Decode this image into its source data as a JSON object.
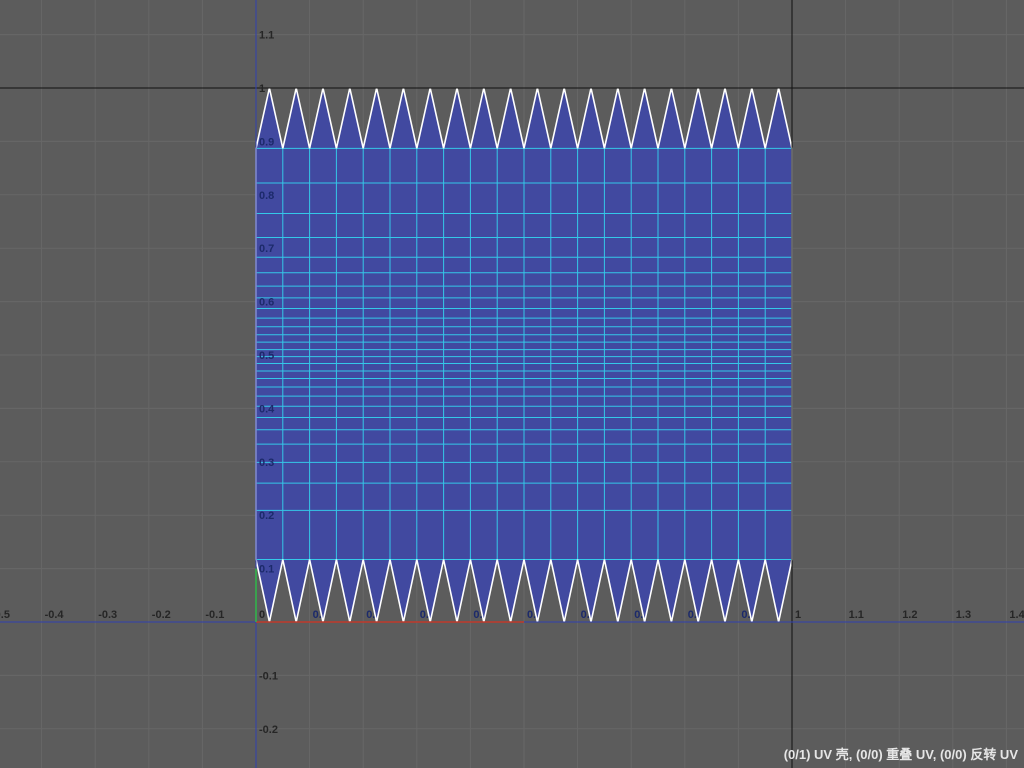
{
  "viewport": {
    "u_range": [
      -0.5,
      1.4
    ],
    "v_range": [
      -0.27,
      1.16
    ],
    "grid_step": 0.1
  },
  "axes": {
    "u_tick_labels": [
      "-0.5",
      "-0.4",
      "-0.3",
      "-0.2",
      "-0.1",
      "0",
      "0.",
      "0.",
      "0.",
      "0.",
      "0.",
      "0.",
      "0.",
      "0.",
      "0.",
      "1",
      "1.1",
      "1.2",
      "1.3",
      "1.4"
    ],
    "u_tick_values": [
      -0.5,
      -0.4,
      -0.3,
      -0.2,
      -0.1,
      0,
      0.1,
      0.2,
      0.3,
      0.4,
      0.5,
      0.6,
      0.7,
      0.8,
      0.9,
      1.0,
      1.1,
      1.2,
      1.3,
      1.4
    ],
    "v_tick_labels": [
      "-0.2",
      "-0.1",
      "0.1",
      "0.2",
      "0.3",
      "0.4",
      "0.5",
      "0.6",
      "0.7",
      "0.8",
      "0.9",
      "1",
      "1.1"
    ],
    "v_tick_values": [
      -0.2,
      -0.1,
      0.1,
      0.2,
      0.3,
      0.4,
      0.5,
      0.6,
      0.7,
      0.8,
      0.9,
      1.0,
      1.1
    ]
  },
  "uv_shell": {
    "u_min": 0.0,
    "u_max": 1.0,
    "v_body_min": 0.117,
    "v_body_max": 0.887,
    "v_tip_min": 0.0,
    "v_tip_max": 1.0,
    "zigzag_teeth": 20,
    "grid_u_lines": [
      0.05,
      0.1,
      0.15,
      0.2,
      0.25,
      0.3,
      0.35,
      0.4,
      0.45,
      0.5,
      0.55,
      0.6,
      0.65,
      0.7,
      0.75,
      0.8,
      0.85,
      0.9,
      0.95
    ],
    "grid_v_lines": [
      0.117,
      0.209,
      0.26,
      0.299,
      0.333,
      0.36,
      0.383,
      0.404,
      0.423,
      0.44,
      0.456,
      0.47,
      0.484,
      0.497,
      0.51,
      0.524,
      0.538,
      0.553,
      0.569,
      0.587,
      0.607,
      0.629,
      0.654,
      0.683,
      0.72,
      0.765,
      0.822,
      0.887
    ]
  },
  "colors": {
    "background": "#5c5c5c",
    "grid": "#676767",
    "u_axis": "#2f3fb0",
    "v_axis": "#2f3fb0",
    "frame_line": "#111111",
    "shell_fill": "#4149a0",
    "shell_edge": "#ffffff",
    "shell_grid": "#34c8e8",
    "label": "#262626",
    "label_inside": "#1c2a6b"
  },
  "status_bar": {
    "text": "(0/1) UV 壳, (0/0) 重叠 UV, (0/0) 反转 UV"
  }
}
